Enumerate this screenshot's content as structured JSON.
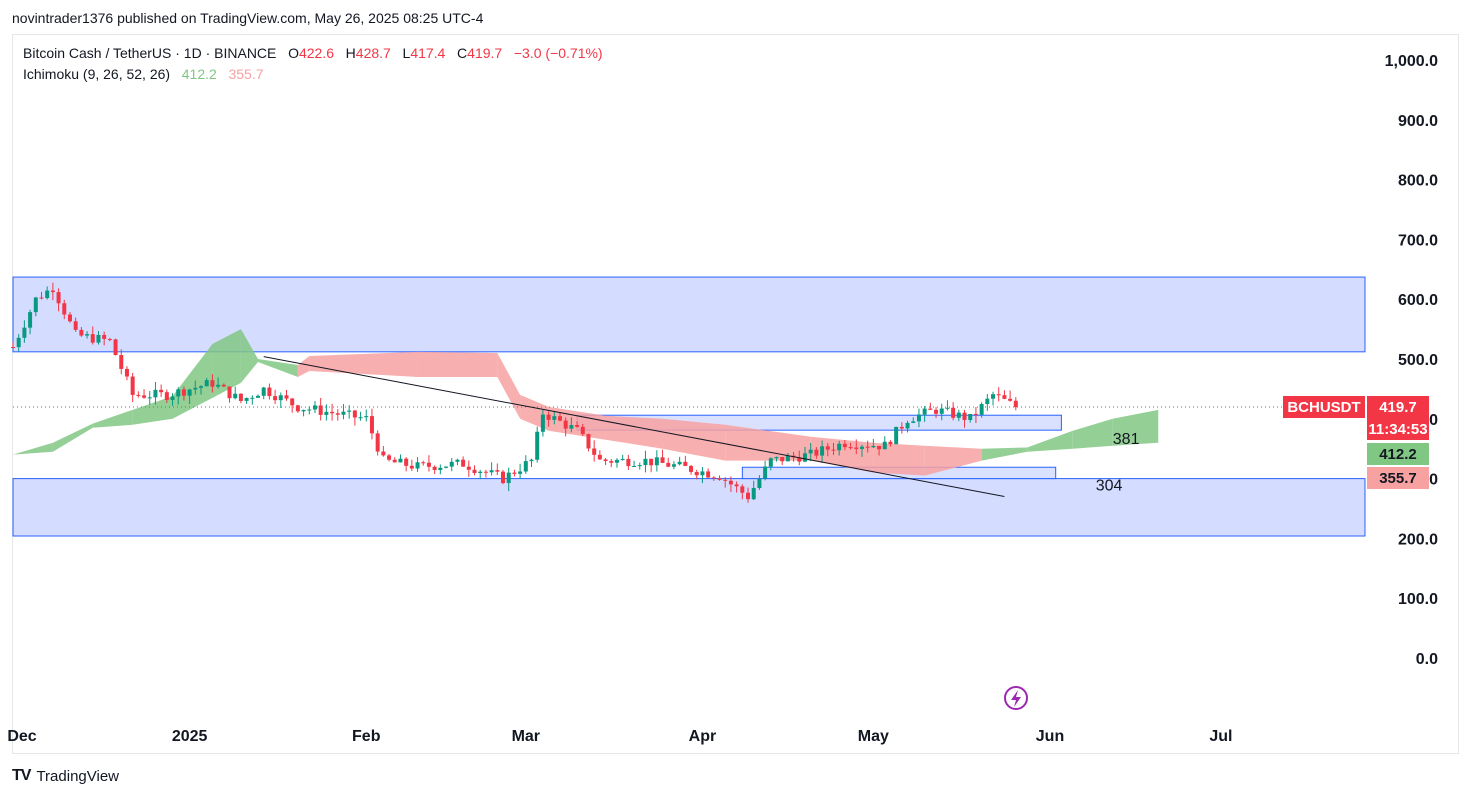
{
  "header": {
    "published": "novintrader1376 published on TradingView.com, May 26, 2025 08:25 UTC-4"
  },
  "legend": {
    "symbol": "Bitcoin Cash / TetherUS · 1D · BINANCE",
    "o_label": "O",
    "o_value": "422.6",
    "h_label": "H",
    "h_value": "428.7",
    "l_label": "L",
    "l_value": "417.4",
    "c_label": "C",
    "c_value": "419.7",
    "change": "−3.0 (−0.71%)",
    "indicator": "Ichimoku (9, 26, 52, 26)",
    "ind_val1": "412.2",
    "ind_val2": "355.7"
  },
  "footer": {
    "brand": "TradingView"
  },
  "colors": {
    "up": "#089981",
    "down": "#f23645",
    "zone": "#d4dcff",
    "zone_border": "#2962ff",
    "cloud_green": "#81c784",
    "cloud_red": "#f7a1a1"
  },
  "chart_data": {
    "type": "candlestick",
    "y_axis": {
      "ticks": [
        1000.0,
        900.0,
        800.0,
        700.0,
        600.0,
        500.0,
        400.0,
        300.0,
        200.0,
        100.0,
        0.0
      ],
      "tick_labels": [
        "1,000.0",
        "900.0",
        "800.0",
        "700.0",
        "600.0",
        "500.0",
        "400.0",
        "300.0",
        "200.0",
        "100.0",
        "0.0"
      ],
      "ylim": [
        0,
        1000
      ]
    },
    "x_axis": {
      "ticks": [
        "Dec",
        "2025",
        "Feb",
        "Mar",
        "Apr",
        "May",
        "Jun",
        "Jul"
      ],
      "tick_dates": [
        "2024-12-01",
        "2025-01-01",
        "2025-02-01",
        "2025-03-01",
        "2025-04-01",
        "2025-05-01",
        "2025-06-01",
        "2025-07-01"
      ]
    },
    "price_labels": [
      {
        "text": "BCHUSDT",
        "value": 419.7,
        "color": "#f23645"
      },
      {
        "text": "419.7",
        "value": 419.7,
        "color": "#f23645"
      },
      {
        "text": "11:34:53",
        "value": 419.7,
        "color": "#f23645"
      },
      {
        "text": "412.2",
        "value": 380,
        "color": "#81c784"
      },
      {
        "text": "355.7",
        "value": 358,
        "color": "#f7a1a1"
      }
    ],
    "zones": [
      {
        "from_date": "2024-12-01",
        "to_date": "2025-07-31",
        "low": 512,
        "high": 637
      },
      {
        "from_date": "2024-12-01",
        "to_date": "2025-07-31",
        "low": 204,
        "high": 300
      },
      {
        "from_date": "2025-03-10",
        "to_date": "2025-06-03",
        "low": 381,
        "high": 406
      },
      {
        "from_date": "2025-04-08",
        "to_date": "2025-06-02",
        "low": 300,
        "high": 319
      }
    ],
    "annotations": [
      {
        "text": "381",
        "date": "2025-06-05",
        "value": 368
      },
      {
        "text": "304",
        "date": "2025-06-02",
        "value": 290
      }
    ],
    "trendline": {
      "from_date": "2025-01-14",
      "from_value": 504,
      "to_date": "2025-05-24",
      "to_value": 270
    },
    "current_price": 419.7,
    "ohlc_summary": {
      "open": 422.6,
      "high": 428.7,
      "low": 417.4,
      "close": 419.7,
      "change": -3.0,
      "change_pct": -0.71
    }
  }
}
